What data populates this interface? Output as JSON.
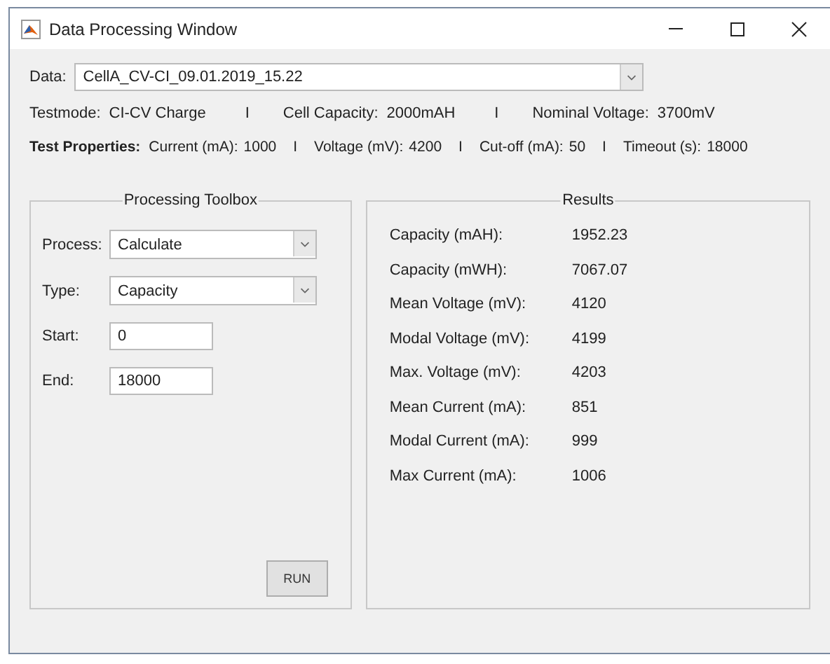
{
  "window": {
    "title": "Data Processing Window"
  },
  "data_select": {
    "label": "Data:",
    "value": "CellA_CV-CI_09.01.2019_15.22"
  },
  "info_line": [
    {
      "label": "Testmode:",
      "value": "CI-CV Charge"
    },
    {
      "separator": "I",
      "label": "Cell Capacity:",
      "value": "2000mAH"
    },
    {
      "separator": "I",
      "label": "Nominal Voltage:",
      "value": "3700mV"
    }
  ],
  "test_properties": {
    "heading": "Test Properties:",
    "items": [
      {
        "label": "Current (mA):",
        "value": "1000"
      },
      {
        "separator": "I",
        "label": "Voltage (mV):",
        "value": "4200"
      },
      {
        "separator": "I",
        "label": "Cut-off (mA):",
        "value": "50"
      },
      {
        "separator": "I",
        "label": "Timeout (s):",
        "value": "18000"
      }
    ]
  },
  "toolbox": {
    "title": "Processing Toolbox",
    "fields": [
      {
        "kind": "dropdown",
        "label": "Process:",
        "value": "Calculate"
      },
      {
        "kind": "dropdown",
        "label": "Type:",
        "value": "Capacity"
      },
      {
        "kind": "input",
        "label": "Start:",
        "value": "0"
      },
      {
        "kind": "input",
        "label": "End:",
        "value": "18000"
      }
    ],
    "run_button": "RUN"
  },
  "results": {
    "title": "Results",
    "rows": [
      {
        "label": "Capacity (mAH):",
        "value": "1952.23"
      },
      {
        "label": "Capacity (mWH):",
        "value": "7067.07"
      },
      {
        "label": "Mean Voltage (mV):",
        "value": "4120"
      },
      {
        "label": "Modal Voltage (mV):",
        "value": "4199"
      },
      {
        "label": "Max. Voltage (mV):",
        "value": "4203"
      },
      {
        "label": "Mean Current (mA):",
        "value": "851"
      },
      {
        "label": "Modal Current (mA):",
        "value": "999"
      },
      {
        "label": "Max Current (mA):",
        "value": "1006"
      }
    ]
  }
}
